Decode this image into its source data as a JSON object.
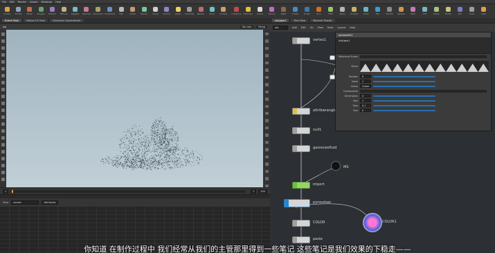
{
  "menubar": {
    "items": [
      "File",
      "Edit",
      "Render",
      "Assets",
      "Windows",
      "Help"
    ]
  },
  "shelf_left": {
    "tools": [
      {
        "label": "Create",
        "color": "#d8a441"
      },
      {
        "label": "Modify",
        "color": "#8fa3b8"
      },
      {
        "label": "Model",
        "color": "#c96a4a"
      },
      {
        "label": "Polygon",
        "color": "#6aa36a"
      },
      {
        "label": "Deform",
        "color": "#9f7dc4"
      },
      {
        "label": "Texture",
        "color": "#c4b07d"
      },
      {
        "label": "Rigging",
        "color": "#7dbac4"
      },
      {
        "label": "Muscles",
        "color": "#c47d8a"
      },
      {
        "label": "Characters",
        "color": "#a3a36a"
      },
      {
        "label": "Constraints",
        "color": "#6a8fc4"
      },
      {
        "label": "Hair",
        "color": "#b8b8b8"
      },
      {
        "label": "Guide",
        "color": "#c49b6a"
      },
      {
        "label": "Terrain",
        "color": "#7dc49b"
      },
      {
        "label": "Cloud",
        "color": "#d0d0d0"
      },
      {
        "label": "Volume",
        "color": "#8a8ac4"
      },
      {
        "label": "Lights",
        "color": "#e6d26a"
      },
      {
        "label": "Cameras",
        "color": "#9a9a9a"
      },
      {
        "label": "Render",
        "color": "#c46a6a"
      },
      {
        "label": "Drive",
        "color": "#6ac4c4"
      },
      {
        "label": "Crowds",
        "color": "#c4a36a"
      }
    ]
  },
  "shelf_right": {
    "tools": [
      {
        "label": "Collisions",
        "color": "#c44a4a"
      },
      {
        "label": "Particles",
        "color": "#e0c040"
      },
      {
        "label": "Grains",
        "color": "#d8d8d8"
      },
      {
        "label": "Vellum",
        "color": "#c46ac4"
      },
      {
        "label": "Rigid",
        "color": "#8a6a4a"
      },
      {
        "label": "Fluids",
        "color": "#4a8ac4"
      },
      {
        "label": "Ocean",
        "color": "#3a7ab4"
      },
      {
        "label": "Pyro",
        "color": "#d86a2a"
      },
      {
        "label": "FEM",
        "color": "#9ac46a"
      },
      {
        "label": "Wires",
        "color": "#b4b4b4"
      },
      {
        "label": "Crowds",
        "color": "#c4b46a"
      },
      {
        "label": "Drive",
        "color": "#6ab4c4"
      },
      {
        "label": "Flip",
        "color": "#3a9ad8"
      },
      {
        "label": "Smoke",
        "color": "#8a8a8a"
      },
      {
        "label": "Sparse",
        "color": "#d4944a"
      },
      {
        "label": "Cloth",
        "color": "#c47db4"
      },
      {
        "label": "Soft",
        "color": "#7db4c4"
      },
      {
        "label": "Solver",
        "color": "#a4c47d"
      },
      {
        "label": "Bullet",
        "color": "#c4c47d"
      },
      {
        "label": "Sim",
        "color": "#7d7dc4"
      },
      {
        "label": "Tools",
        "color": "#9d9d9d"
      },
      {
        "label": "Labs",
        "color": "#e0a040"
      }
    ]
  },
  "tabs_left": [
    {
      "label": "Scene View",
      "active": true
    },
    {
      "label": "Motion FX View",
      "active": false
    },
    {
      "label": "Geometry Spreadsheet",
      "active": false
    }
  ],
  "tabs_right": [
    {
      "label": "/obj/geo1",
      "active": true
    },
    {
      "label": "Tree View",
      "active": false
    },
    {
      "label": "Material Palette",
      "active": false
    }
  ],
  "viewport": {
    "toolbar_left": "obj",
    "camera_label": "No cam",
    "persp_label": "Persp"
  },
  "timeline": {
    "frame": "1",
    "start": "1",
    "end": "240",
    "fields": [
      "1",
      "1",
      "240",
      "240"
    ]
  },
  "sheet": {
    "node_field": "smoke",
    "filter_label": "Attributes",
    "view_label": "View"
  },
  "net_toolbar": {
    "path": "obj",
    "menus": [
      "Add",
      "Edit",
      "Go",
      "View",
      "Tools",
      "Layout",
      "Help"
    ]
  },
  "nodes": [
    {
      "id": "n1",
      "label": "vertex1",
      "sub": "",
      "kind": "grey"
    },
    {
      "id": "n2",
      "label": "attribwrangle",
      "sub": "",
      "kind": "grey"
    },
    {
      "id": "n3",
      "label": "null1",
      "sub": "",
      "kind": "grey"
    },
    {
      "id": "n4",
      "label": "gasresizefluid",
      "sub": "",
      "kind": "grey"
    },
    {
      "id": "n5",
      "label": "MS",
      "sub": "",
      "kind": "round"
    },
    {
      "id": "n6",
      "label": "import",
      "sub": "",
      "kind": "green"
    },
    {
      "id": "n7",
      "label": "pyrosolver",
      "sub": "",
      "kind": "blue"
    },
    {
      "id": "n8",
      "label": "COLOR",
      "sub": "",
      "kind": "grey"
    },
    {
      "id": "n9",
      "label": "COLOR1",
      "sub": "",
      "kind": "round-blue"
    },
    {
      "id": "n10",
      "label": "paste",
      "sub": "",
      "kind": "grey"
    }
  ],
  "params": {
    "title": "pyrosolver1",
    "path_label": "/obj/geo1",
    "rows": [
      {
        "label": "Reference Frame",
        "value": ""
      },
      {
        "label": "Ramp",
        "value": ""
      },
      {
        "label": "Position",
        "value": "0"
      },
      {
        "label": "Value",
        "value": "1"
      },
      {
        "label": "Interp",
        "value": "Linear"
      },
      {
        "label": "Components",
        "value": ""
      },
      {
        "label": "Dimensions",
        "value": "0"
      },
      {
        "label": "Max",
        "value": "1"
      },
      {
        "label": "Step",
        "value": "0.1"
      },
      {
        "label": "Size",
        "value": "0"
      }
    ]
  },
  "subtitle": "你知道 在制作过程中 我们经常从我们的主管那里得到一些笔记 这些笔记是我们效果的下稳走——"
}
